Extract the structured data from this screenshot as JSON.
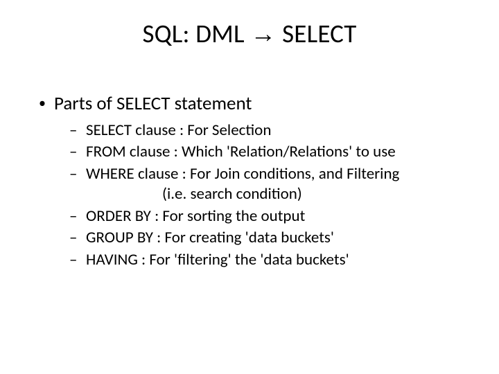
{
  "title_pre": "SQL: DML ",
  "title_arrow": "→",
  "title_post": " SELECT",
  "bullet1": "Parts of SELECT statement",
  "sub": {
    "a": "SELECT clause : For Selection",
    "b": "FROM clause : Which 'Relation/Relations' to use",
    "c": "WHERE clause : For Join conditions, and Filtering",
    "c2": "(i.e. search condition)",
    "d": "ORDER BY : For sorting the output",
    "e": "GROUP BY : For creating 'data buckets'",
    "f": "HAVING : For 'filtering' the 'data buckets'"
  }
}
